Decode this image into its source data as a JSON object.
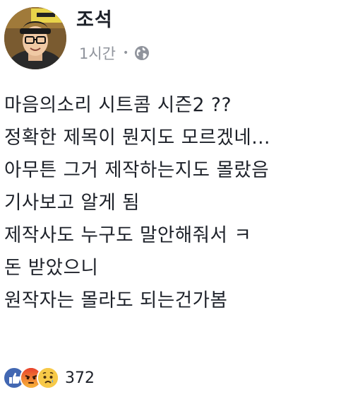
{
  "post": {
    "author": "조석",
    "timestamp": "1시간",
    "separator": "•",
    "privacy_icon": "globe-icon",
    "lines": [
      "마음의소리 시트콤 시즌2 ??",
      "정확한 제목이 뭔지도 모르겠네...",
      "아무튼 그거 제작하는지도 몰랐음",
      "기사보고 알게 됨",
      "제작사도 누구도 말안해줘서 ㅋ",
      "돈 받았으니",
      "원작자는 몰라도 되는건가봄"
    ],
    "reactions": {
      "icons": [
        "like-icon",
        "angry-icon",
        "sad-icon"
      ],
      "count": "372"
    }
  },
  "colors": {
    "like": "#4267b2",
    "angry": "#f0572f",
    "sad": "#f7c948",
    "meta_text": "#90949c",
    "body_text": "#1d2129"
  }
}
